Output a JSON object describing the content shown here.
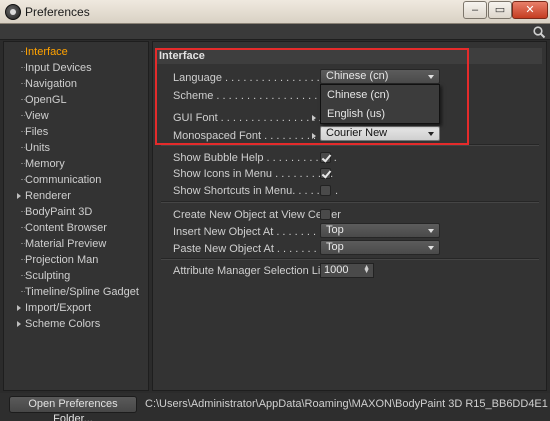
{
  "window": {
    "title": "Preferences",
    "minimize_label": "–",
    "maximize_label": "▭",
    "close_label": "✕"
  },
  "sidebar": {
    "items": [
      {
        "label": "Interface",
        "selected": true,
        "expandable": false
      },
      {
        "label": "Input Devices",
        "selected": false,
        "expandable": false
      },
      {
        "label": "Navigation",
        "selected": false,
        "expandable": false
      },
      {
        "label": "OpenGL",
        "selected": false,
        "expandable": false
      },
      {
        "label": "View",
        "selected": false,
        "expandable": false
      },
      {
        "label": "Files",
        "selected": false,
        "expandable": false
      },
      {
        "label": "Units",
        "selected": false,
        "expandable": false
      },
      {
        "label": "Memory",
        "selected": false,
        "expandable": false
      },
      {
        "label": "Communication",
        "selected": false,
        "expandable": false
      },
      {
        "label": "Renderer",
        "selected": false,
        "expandable": true
      },
      {
        "label": "BodyPaint 3D",
        "selected": false,
        "expandable": false
      },
      {
        "label": "Content Browser",
        "selected": false,
        "expandable": false
      },
      {
        "label": "Material Preview",
        "selected": false,
        "expandable": false
      },
      {
        "label": "Projection Man",
        "selected": false,
        "expandable": false
      },
      {
        "label": "Sculpting",
        "selected": false,
        "expandable": false
      },
      {
        "label": "Timeline/Spline Gadget",
        "selected": false,
        "expandable": false
      },
      {
        "label": "Import/Export",
        "selected": false,
        "expandable": true
      },
      {
        "label": "Scheme Colors",
        "selected": false,
        "expandable": true
      }
    ]
  },
  "interface": {
    "section_title": "Interface",
    "language_label": "Language . . . . . . . . . . . . . . . . . . .",
    "language_value": "Chinese (cn)",
    "language_options": [
      "Chinese (cn)",
      "English (us)"
    ],
    "scheme_label": "Scheme . . . . . . . . . . . . . . . . . . . . .",
    "gui_font_label": "GUI Font . . . . . . . . . . . . . . . . . .",
    "mono_font_label": "Monospaced Font . . . . . . . . . . .",
    "mono_font_value": "Courier New",
    "bubble_help_label": "Show Bubble Help . . . . . . . . . . . .",
    "bubble_help_checked": true,
    "icons_menu_label": "Show Icons in Menu . . . . . . . . . .",
    "icons_menu_checked": true,
    "shortcuts_menu_label": "Show Shortcuts in Menu. . . . . . . .",
    "shortcuts_menu_checked": false,
    "new_object_center_label": "Create New Object at View Center",
    "new_object_center_checked": false,
    "insert_new_label": "Insert New Object At . . . . . . . . . .",
    "insert_new_value": "Top",
    "paste_new_label": "Paste New Object At . . . . . . . . . .",
    "paste_new_value": "Top",
    "attr_limit_label": "Attribute Manager Selection Limit",
    "attr_limit_value": "1000"
  },
  "footer": {
    "open_folder_label": "Open Preferences Folder...",
    "path": "C:\\Users\\Administrator\\AppData\\Roaming\\MAXON\\BodyPaint 3D R15_BB6DD4E1"
  },
  "colors": {
    "selected_item": "#ffa200",
    "highlight_box": "#e52b2b",
    "panel_bg": "#333333"
  }
}
